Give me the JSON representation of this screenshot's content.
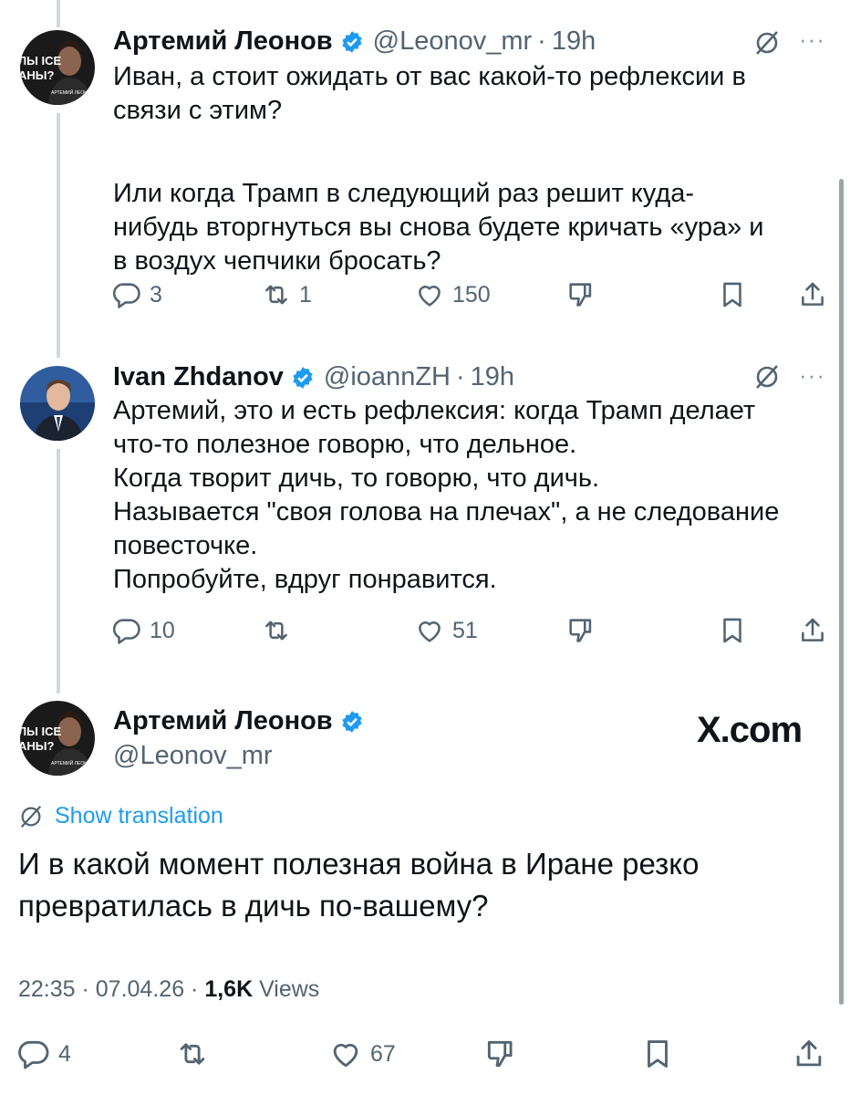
{
  "tweet1": {
    "name": "Артемий Леонов",
    "handle": "@Leonov_mr",
    "time": "19h",
    "lines_a": [
      "Иван, а стоит ожидать от вас какой-то рефлексии в",
      "связи с этим?"
    ],
    "lines_b": [
      "Или когда Трамп в следующий раз решит куда-",
      "нибудь вторгнуться вы снова будете кричать «ура» и",
      "в воздух чепчики бросать?"
    ],
    "replies": "3",
    "reposts": "1",
    "likes": "150"
  },
  "tweet2": {
    "name": "Ivan Zhdanov",
    "handle": "@ioannZH",
    "time": "19h",
    "lines": [
      "Артемий, это и есть рефлексия: когда Трамп делает",
      "что-то полезное говорю, что дельное.",
      "Когда творит дичь, то говорю, что дичь.",
      "Называется \"своя голова на плечах\", а не следование",
      "повесточке.",
      "Попробуйте, вдруг понравится."
    ],
    "replies": "10",
    "reposts": "",
    "likes": "51"
  },
  "focus": {
    "name": "Артемий Леонов",
    "handle": "@Leonov_mr",
    "watermark": "X.com",
    "translate_label": "Show translation",
    "lines": [
      "И в какой момент полезная война в Иране резко",
      "превратилась в дичь по-вашему?"
    ],
    "time": "22:35 · 07.04.26 · ",
    "views_count": "1,6K",
    "views_label": " Views",
    "replies": "4",
    "likes": "67"
  },
  "avatar_text": {
    "line1": "ЛЫ ICE",
    "line2": "АНЫ?",
    "caption": "АРТЕМИЙ ЛЕОНОВ"
  },
  "colors": {
    "accent": "#1d9bf0",
    "muted": "#536471",
    "text": "#0f1419",
    "thread_line": "#cfd9de"
  },
  "icons": [
    "reply-icon",
    "repost-icon",
    "like-icon",
    "dislike-icon",
    "bookmark-icon",
    "share-icon",
    "grok-icon",
    "more-icon",
    "verified-icon",
    "translate-icon"
  ]
}
